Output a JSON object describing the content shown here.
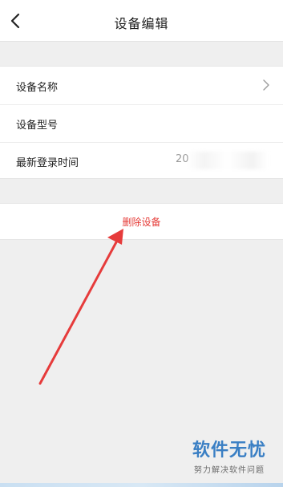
{
  "header": {
    "title": "设备编辑",
    "back_icon": "chevron-left-icon"
  },
  "info_rows": [
    {
      "label": "设备名称",
      "value": "",
      "has_chevron": true
    },
    {
      "label": "设备型号",
      "value": ""
    },
    {
      "label": "最新登录时间",
      "value": "20"
    }
  ],
  "actions": {
    "delete_label": "删除设备"
  },
  "annotation": {
    "arrow_color": "#e63b3b"
  },
  "watermark": {
    "title": "软件无忧",
    "subtitle": "努力解决软件问题"
  },
  "colors": {
    "background": "#efefef",
    "danger": "#e53935"
  }
}
